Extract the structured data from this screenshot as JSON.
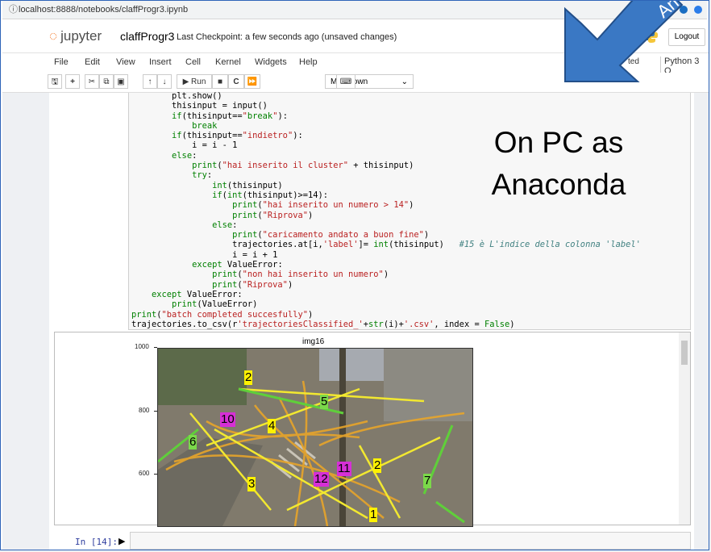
{
  "browser": {
    "url": "localhost:8888/notebooks/claffProgr3.ipynb",
    "info_glyph": "ⓘ"
  },
  "jupyter": {
    "logo_text": "jupyter",
    "notebook_name": "claffProgr3",
    "checkpoint": "Last Checkpoint: a few seconds ago  (unsaved changes)",
    "logout_label": "Logout"
  },
  "menubar": {
    "items": [
      "File",
      "Edit",
      "View",
      "Insert",
      "Cell",
      "Kernel",
      "Widgets",
      "Help"
    ],
    "trusted": "ted",
    "kernel": "Python 3"
  },
  "toolbar": {
    "run_label": "▶ Run",
    "cell_type": "Markdown"
  },
  "code_lines": [
    "        plt.show()",
    "        thisinput = input()",
    "        if(thisinput==\"break\"):",
    "            break",
    "        if(thisinput==\"indietro\"):",
    "            i = i - 1",
    "        else:",
    "            print(\"hai inserito il cluster\" + thisinput)",
    "            try:",
    "                int(thisinput)",
    "                if(int(thisinput)>=14):",
    "                    print(\"hai inserito un numero > 14\")",
    "                    print(\"Riprova\")",
    "                else:",
    "                    print(\"caricamento andato a buon fine\")",
    "                    trajectories.at[i,'label']= int(thisinput)   #15 è L'indice della colonna 'label'",
    "                    i = i + 1",
    "            except ValueError:",
    "                print(\"non hai inserito un numero\")",
    "                print(\"Riprova\")",
    "    except ValueError:",
    "        print(ValueError)",
    "print(\"batch completed succesfully\")",
    "trajectories.to_csv(r'trajectoriesClassified_'+str(i)+'.csv', index = False)"
  ],
  "annotation": {
    "line1": "On PC as",
    "line2": "Anaconda",
    "corner_text": "An"
  },
  "output": {
    "plot_title": "img16",
    "yticks": [
      "1000",
      "800",
      "600"
    ],
    "cluster_labels": [
      {
        "text": "2",
        "color": "yellow"
      },
      {
        "text": "5",
        "color": "green"
      },
      {
        "text": "10",
        "color": "magenta"
      },
      {
        "text": "4",
        "color": "yellow"
      },
      {
        "text": "6",
        "color": "green"
      },
      {
        "text": "2",
        "color": "yellow"
      },
      {
        "text": "11",
        "color": "magenta"
      },
      {
        "text": "12",
        "color": "magenta"
      },
      {
        "text": "3",
        "color": "yellow"
      },
      {
        "text": "7",
        "color": "green"
      },
      {
        "text": "1",
        "color": "yellow"
      }
    ]
  },
  "input_cell": {
    "prompt": "In [14]:"
  }
}
